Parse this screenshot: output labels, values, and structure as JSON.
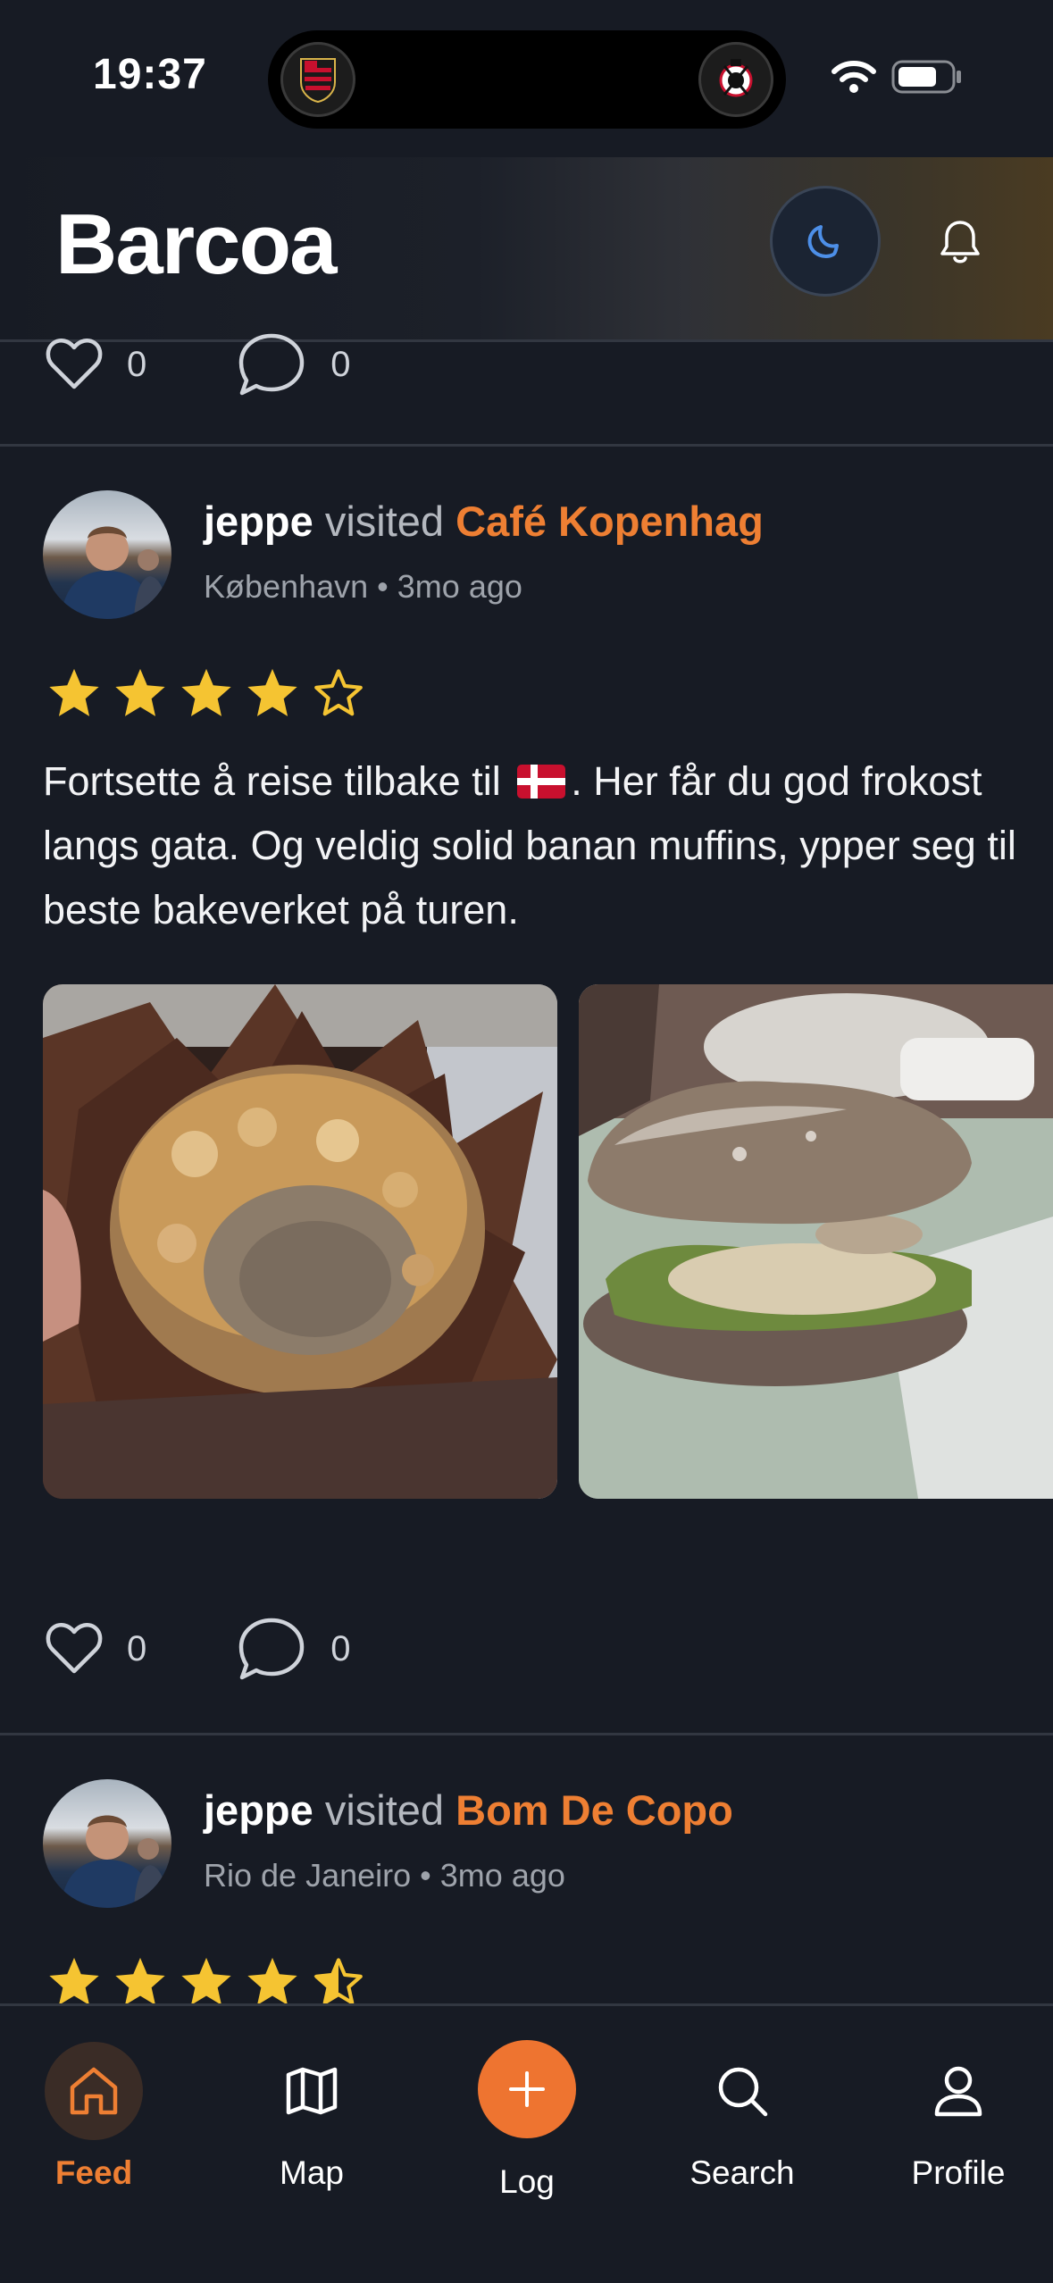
{
  "status_bar": {
    "time": "19:37",
    "battery_level": 0.7
  },
  "header": {
    "brand": "Barcoa",
    "theme_toggle_icon": "moon-icon",
    "notifications_icon": "bell-icon"
  },
  "top_actions": {
    "likes": "0",
    "comments": "0"
  },
  "posts": [
    {
      "user": "jeppe",
      "verb": "visited",
      "place": "Café Kopenhag",
      "city": "København",
      "separator": "•",
      "time_ago": "3mo ago",
      "rating": 4,
      "text_before_flag": "Fortsette å reise tilbake til",
      "flag": "Denmark flag",
      "text_after_flag": ". Her får du god frokost langs gata. Og veldig solid banan muffins, ypper seg til beste bakeverket på turen.",
      "photos": [
        "banana muffin",
        "sandwich"
      ],
      "likes": "0",
      "comments": "0"
    },
    {
      "user": "jeppe",
      "verb": "visited",
      "place": "Bom De Copo",
      "city": "Rio de Janeiro",
      "separator": "•",
      "time_ago": "3mo ago",
      "rating": 4.5
    }
  ],
  "nav": {
    "items": [
      {
        "label": "Feed",
        "icon": "home-icon",
        "active": true
      },
      {
        "label": "Map",
        "icon": "map-icon",
        "active": false
      },
      {
        "label": "Log",
        "icon": "plus-icon",
        "active": false
      },
      {
        "label": "Search",
        "icon": "search-icon",
        "active": false
      },
      {
        "label": "Profile",
        "icon": "user-icon",
        "active": false
      }
    ]
  },
  "colors": {
    "accent": "#ee7f33",
    "star": "#f5c432",
    "background": "#171b24",
    "theme_icon": "#4d8fe8"
  }
}
